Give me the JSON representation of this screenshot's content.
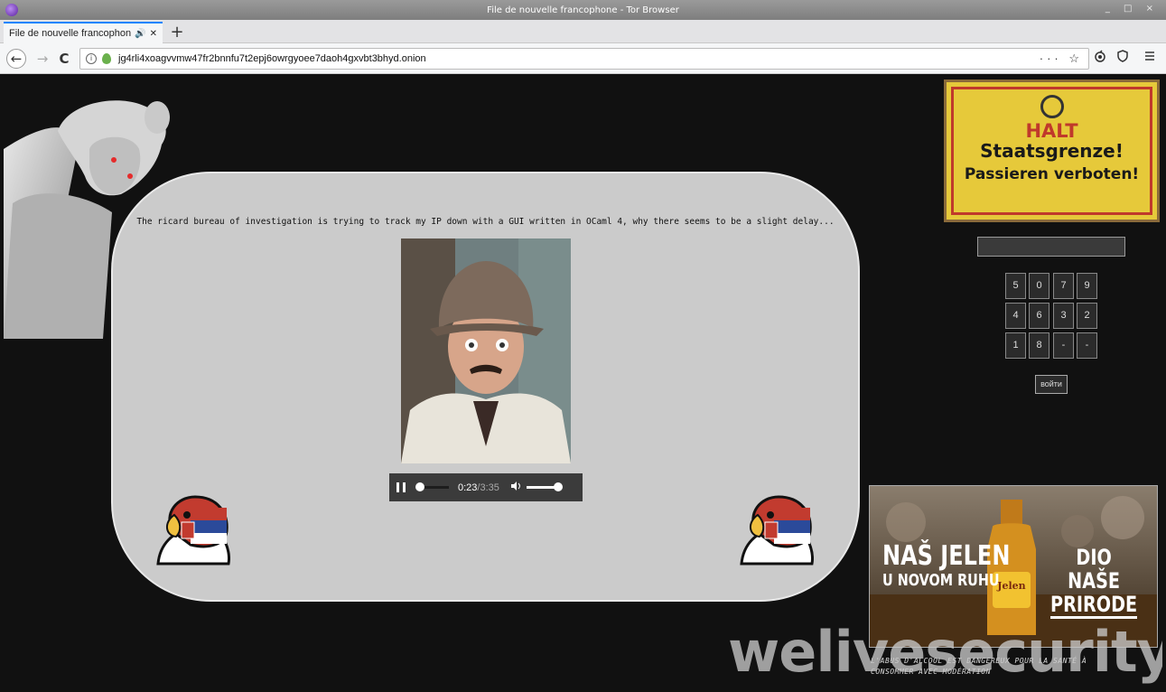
{
  "window": {
    "title": "File de nouvelle francophone - Tor Browser",
    "controls": "_ □ ×"
  },
  "tabs": [
    {
      "label": "File de nouvelle francophone",
      "audio_icon": "🔊",
      "close_icon": "✕"
    }
  ],
  "new_tab_icon": "+",
  "nav": {
    "back_icon": "←",
    "forward_icon": "→",
    "reload_icon": "C",
    "url": "jg4rli4xoagvvmw47fr2bnnfu7t2epj6owrgyoee7daoh4gxvbt3bhyd.onion",
    "url_actions": "··· ☆",
    "right_icons": [
      "onion-circuit-icon",
      "shield-icon",
      "menu-icon"
    ]
  },
  "page": {
    "message": "The ricard bureau of investigation is trying to track my IP down with a GUI written in OCaml 4, why there seems to be a slight delay...",
    "player": {
      "current_time": "0:23",
      "separator": " / ",
      "total_time": "3:35",
      "progress": 0.107,
      "volume": 1.0
    },
    "halt_sign": {
      "line1": "HALT",
      "line2": "Staatsgrenze!",
      "line3": "Passieren verboten!"
    },
    "code_input": {
      "value": ""
    },
    "keypad": [
      "5",
      "0",
      "7",
      "9",
      "4",
      "6",
      "3",
      "2",
      "1",
      "8",
      "-",
      "-"
    ],
    "login_label": "войти",
    "ad": {
      "left_line1": "NAŠ JELEN",
      "left_line2": "U NOVOM RUHU",
      "right_line1": "DIO NAŠE",
      "right_line2": "PRIRODE",
      "bottle_label": "Jelen",
      "disclaimer": "L'ABUS D'ALCOOL EST DANGEREUX POUR LA SANTÉ À CONSOMMER AVEC MODÉRATION"
    },
    "watermark": "welivesecurity"
  },
  "colors": {
    "page_bg": "#111111",
    "panel_bg": "#cbcbcb",
    "halt_yellow": "#e6c93a",
    "halt_red": "#c0392b",
    "tab_accent": "#0a84ff"
  }
}
